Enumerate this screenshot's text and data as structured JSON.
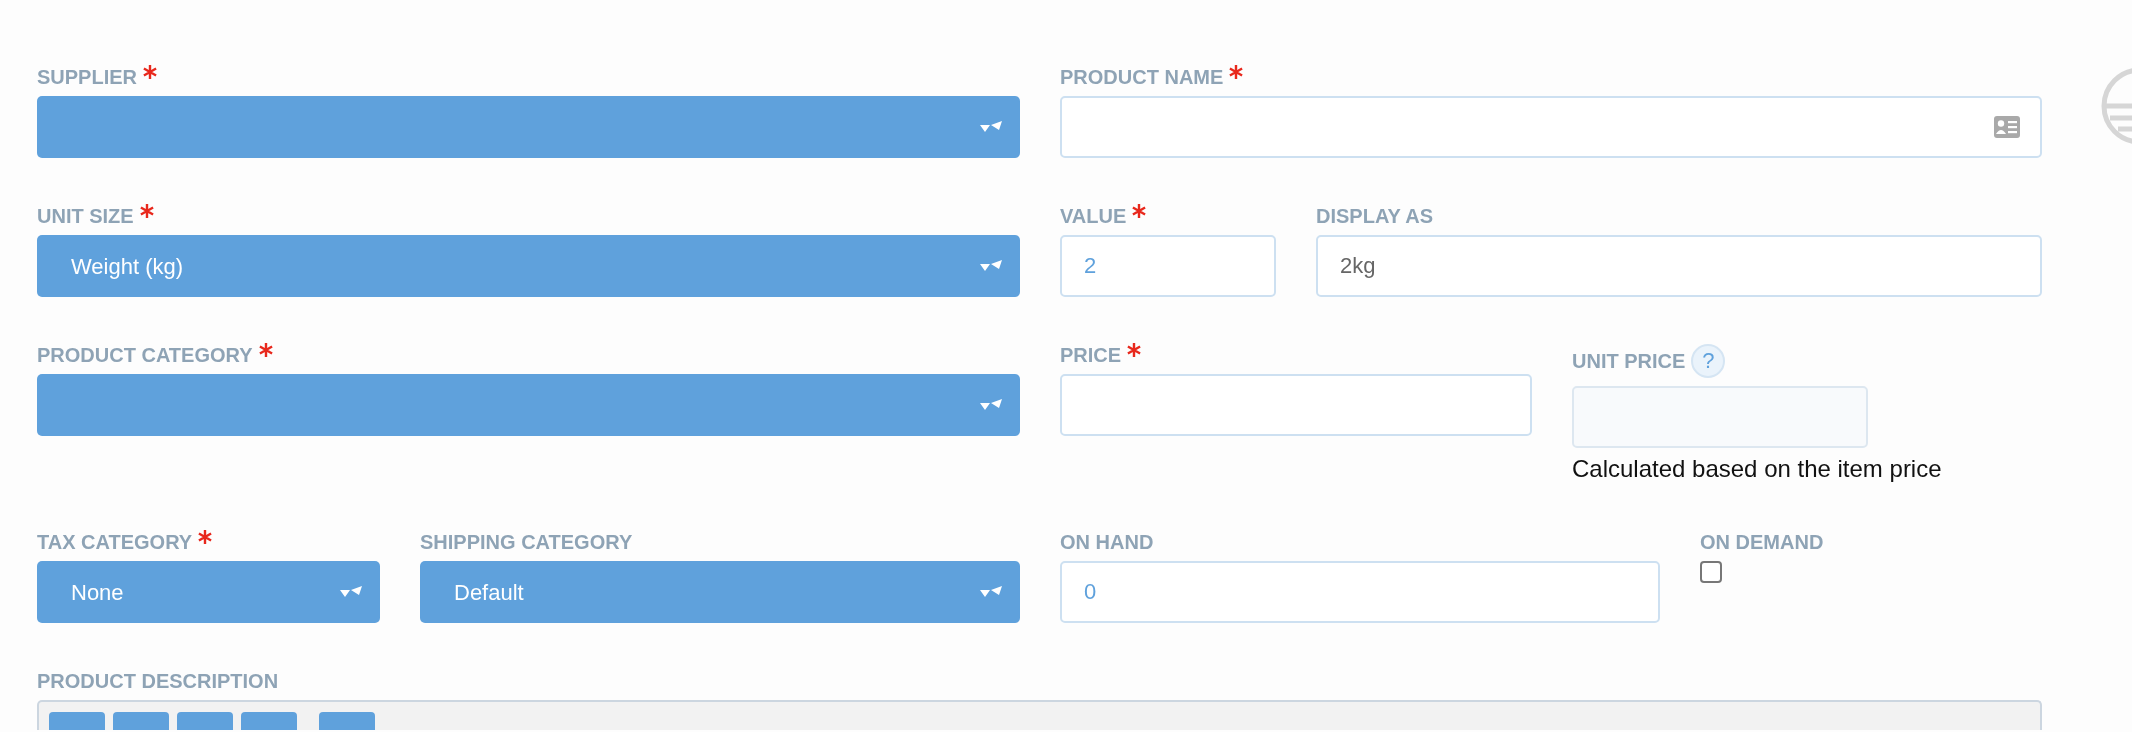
{
  "rows": [
    {
      "fields": [
        {
          "kind": "select",
          "label": "SUPPLIER",
          "required": true
        },
        {
          "kind": "card-input",
          "label": "PRODUCT NAME",
          "required": true
        }
      ]
    },
    {
      "fields": [
        {
          "kind": "select",
          "label": "UNIT SIZE",
          "required": true,
          "value": "Weight (kg)"
        },
        {
          "kind": "input",
          "label": "VALUE",
          "required": true,
          "value": "2"
        },
        {
          "kind": "input",
          "label": "DISPLAY AS",
          "required": false,
          "placeholder": "2kg"
        }
      ]
    },
    {
      "fields": [
        {
          "kind": "select",
          "label": "PRODUCT CATEGORY",
          "required": true
        },
        {
          "kind": "input",
          "label": "PRICE",
          "required": true
        },
        {
          "kind": "readonly",
          "label": "UNIT PRICE",
          "required": false,
          "help": "?",
          "hint": "Calculated based on the item price"
        }
      ]
    },
    {
      "fields": [
        {
          "kind": "select",
          "label": "TAX CATEGORY",
          "required": true,
          "value": "None"
        },
        {
          "kind": "select",
          "label": "SHIPPING CATEGORY",
          "required": false,
          "value": "Default"
        },
        {
          "kind": "input",
          "label": "ON HAND",
          "required": false,
          "value": "0"
        },
        {
          "kind": "checkbox",
          "label": "ON DEMAND",
          "required": false,
          "checked": false
        }
      ]
    }
  ],
  "description": {
    "label": "PRODUCT DESCRIPTION",
    "toolbar": [
      {
        "kind": "format"
      },
      {
        "kind": "format"
      },
      {
        "kind": "format"
      },
      {
        "kind": "format"
      },
      {
        "kind": "tool"
      }
    ]
  }
}
